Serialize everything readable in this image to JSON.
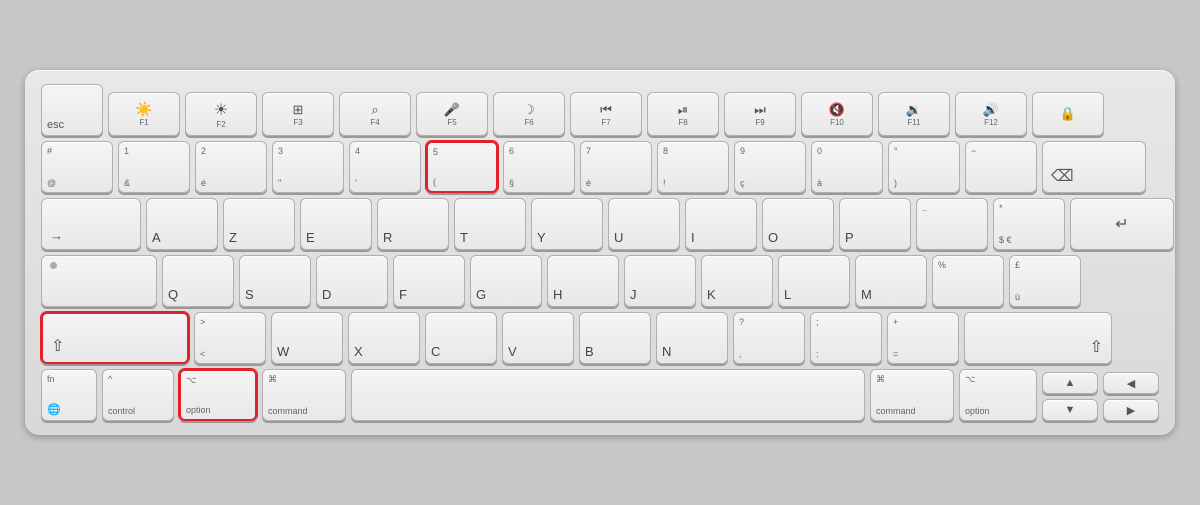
{
  "keyboard": {
    "rows": [
      {
        "id": "fn-row",
        "keys": [
          {
            "id": "esc",
            "label": "esc",
            "type": "esc"
          },
          {
            "id": "f1",
            "label": "F1",
            "icon": "☀",
            "type": "fn-key"
          },
          {
            "id": "f2",
            "label": "F2",
            "icon": "☀",
            "type": "fn-key"
          },
          {
            "id": "f3",
            "label": "F3",
            "icon": "⊞",
            "type": "fn-key"
          },
          {
            "id": "f4",
            "label": "F4",
            "icon": "🔍",
            "type": "fn-key"
          },
          {
            "id": "f5",
            "label": "F5",
            "icon": "🎤",
            "type": "fn-key"
          },
          {
            "id": "f6",
            "label": "F6",
            "icon": "☽",
            "type": "fn-key"
          },
          {
            "id": "f7",
            "label": "F7",
            "icon": "⏮",
            "type": "fn-key"
          },
          {
            "id": "f8",
            "label": "F8",
            "icon": "⏯",
            "type": "fn-key"
          },
          {
            "id": "f9",
            "label": "F9",
            "icon": "⏭",
            "type": "fn-key"
          },
          {
            "id": "f10",
            "label": "F10",
            "icon": "🔇",
            "type": "fn-key"
          },
          {
            "id": "f11",
            "label": "F11",
            "icon": "🔉",
            "type": "fn-key"
          },
          {
            "id": "f12",
            "label": "F12",
            "icon": "🔊",
            "type": "fn-key"
          },
          {
            "id": "lock",
            "label": "",
            "icon": "🔒",
            "type": "fn-key"
          }
        ]
      }
    ]
  }
}
